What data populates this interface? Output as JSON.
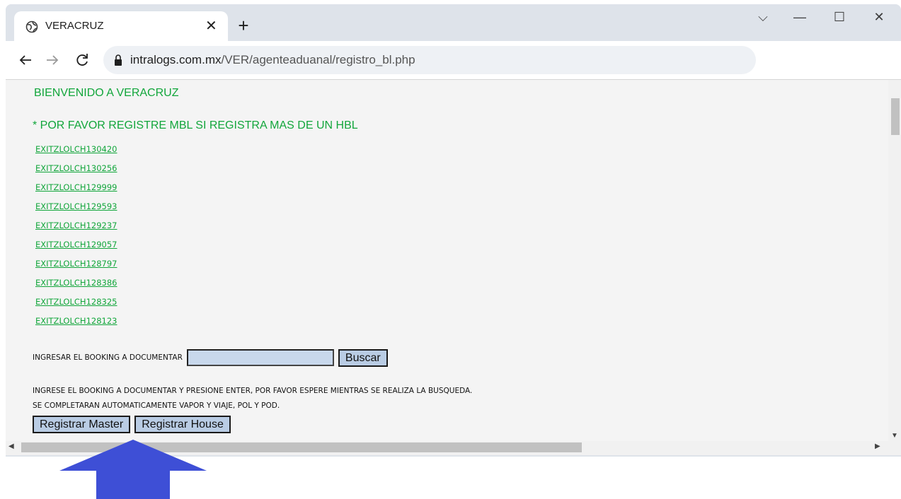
{
  "browser": {
    "tab_title": "VERACRUZ",
    "url_host": "intralogs.com.mx",
    "url_path": "/VER/agenteaduanal/registro_bl.php",
    "icons": [
      "globe-icon",
      "close-icon",
      "plus-icon",
      "back-icon",
      "forward-icon",
      "reload-icon",
      "lock-icon",
      "chevron-down-icon",
      "minimize-icon",
      "maximize-icon"
    ]
  },
  "page": {
    "welcome": "BIENVENIDO A VERACRUZ",
    "notice": "* POR FAVOR REGISTRE MBL SI REGISTRA MAS DE UN HBL",
    "links": [
      "EXITZLOLCH130420",
      "EXITZLOLCH130256",
      "EXITZLOLCH129999",
      "EXITZLOLCH129593",
      "EXITZLOLCH129237",
      "EXITZLOLCH129057",
      "EXITZLOLCH128797",
      "EXITZLOLCH128386",
      "EXITZLOLCH128325",
      "EXITZLOLCH128123"
    ],
    "booking_label": "INGRESAR EL BOOKING A DOCUMENTAR",
    "booking_value": "",
    "search_button": "Buscar",
    "info_line1": "INGRESE EL BOOKING A DOCUMENTAR Y PRESIONE ENTER, POR FAVOR ESPERE MIENTRAS SE REALIZA LA BUSQUEDA.",
    "info_line2": "SE COMPLETARAN AUTOMATICAMENTE VAPOR Y VIAJE, POL Y POD.",
    "register_master": "Registrar Master",
    "register_house": "Registrar House"
  },
  "colors": {
    "link_green": "#12a63b",
    "button_bg": "#b9cce4",
    "arrow_blue": "#3e4fd6"
  }
}
